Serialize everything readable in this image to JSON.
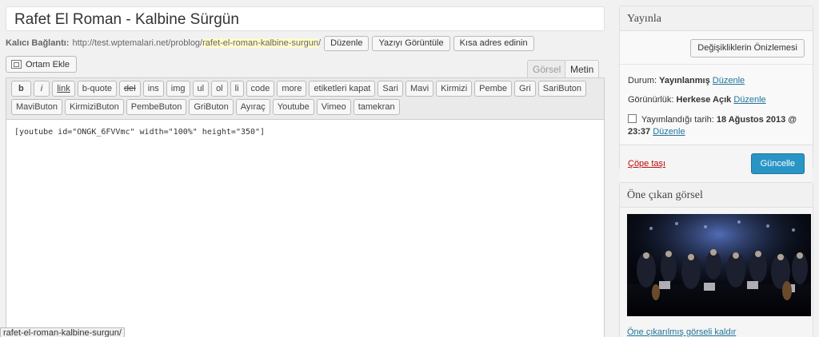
{
  "post": {
    "title": "Rafet El Roman - Kalbine Sürgün",
    "permalink_label": "Kalıcı Bağlantı:",
    "permalink_base": "http://test.wptemalari.net/problog/",
    "permalink_slug": "rafet-el-roman-kalbine-surgun",
    "permalink_tail": "/",
    "buttons": {
      "edit": "Düzenle",
      "view": "Yazıyı Görüntüle",
      "shortlink": "Kısa adres edinin"
    }
  },
  "media": {
    "add_label": "Ortam Ekle",
    "icon": "media-icon"
  },
  "editor": {
    "tabs": {
      "visual": "Görsel",
      "text": "Metin"
    },
    "quicktags": [
      "b",
      "i",
      "link",
      "b-quote",
      "del",
      "ins",
      "img",
      "ul",
      "ol",
      "li",
      "code",
      "more",
      "etiketleri kapat",
      "Sari",
      "Mavi",
      "Kirmizi",
      "Pembe",
      "Gri",
      "SariButon",
      "MaviButon",
      "KirmiziButon",
      "PembeButon",
      "GriButon",
      "Ayıraç",
      "Youtube",
      "Vimeo",
      "tamekran"
    ],
    "content": "[youtube id=\"ONGK_6FVVmc\" width=\"100%\" height=\"350\"]"
  },
  "statusbar": {
    "text": "rafet-el-roman-kalbine-surgun/"
  },
  "publish": {
    "heading": "Yayınla",
    "preview_label": "Değişikliklerin Önizlemesi",
    "status_label": "Durum:",
    "status_value": "Yayınlanmış",
    "visibility_label": "Görünürlük:",
    "visibility_value": "Herkese Açık",
    "date_label": "Yayımlandığı tarih:",
    "date_value": "18 Ağustos 2013 @",
    "time_value": "23:37",
    "edit_link": "Düzenle",
    "trash_label": "Çöpe taşı",
    "update_label": "Güncelle",
    "accent": "#2a95c5",
    "trash_color": "#bc0b0b"
  },
  "featured": {
    "heading": "Öne çıkan görsel",
    "remove_label": "Öne çıkarılmış görseli kaldır"
  }
}
